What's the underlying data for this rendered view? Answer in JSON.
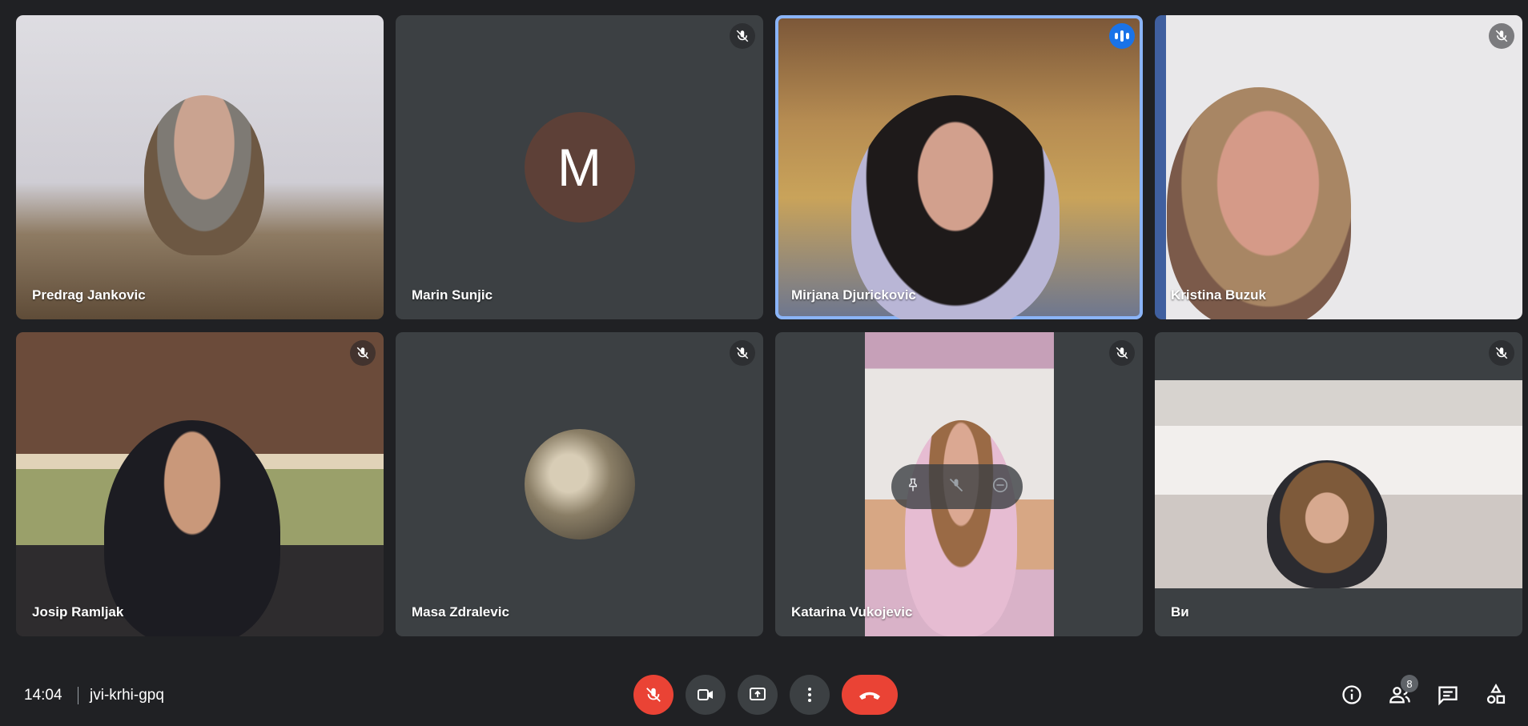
{
  "participants": [
    {
      "name": "Predrag Jankovic",
      "muted": false,
      "video": true
    },
    {
      "name": "Marin Sunjic",
      "muted": true,
      "video": false,
      "avatar_letter": "M",
      "avatar_color": "#5d4037"
    },
    {
      "name": "Mirjana Djurickovic",
      "muted": false,
      "video": true,
      "speaking": true
    },
    {
      "name": "Kristina Buzuk",
      "muted": true,
      "video": true
    },
    {
      "name": "Josip Ramljak",
      "muted": true,
      "video": true
    },
    {
      "name": "Masa Zdralevic",
      "muted": true,
      "video": false,
      "avatar_image": "saxophone"
    },
    {
      "name": "Katarina Vukojevic",
      "muted": true,
      "video": true
    },
    {
      "name": "Ви",
      "muted": true,
      "video": true
    }
  ],
  "meeting": {
    "time": "14:04",
    "code": "jvi-krhi-gpq"
  },
  "people_count": "8",
  "colors": {
    "speaking_border": "#8ab4f8",
    "hangup": "#ea4335",
    "background": "#202124",
    "tile": "#3c4043"
  }
}
